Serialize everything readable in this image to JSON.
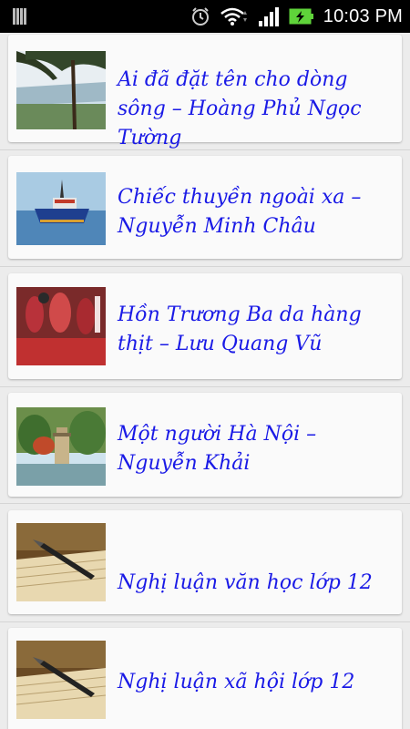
{
  "status_bar": {
    "time": "10:03 PM",
    "icons": [
      "notification-icon",
      "alarm-icon",
      "wifi-icon",
      "signal-icon",
      "battery-charging-icon"
    ]
  },
  "articles": [
    {
      "title": "Ai đã đặt tên cho dòng sông – Hoàng Phủ Ngọc Tường",
      "thumbnail": "river-landscape"
    },
    {
      "title": "Chiếc thuyền ngoài xa – Nguyễn Minh Châu",
      "thumbnail": "fishing-boat"
    },
    {
      "title": "Hồn Trương Ba da hàng thịt – Lưu Quang Vũ",
      "thumbnail": "meat-market"
    },
    {
      "title": "Một người Hà Nội – Nguyễn Khải",
      "thumbnail": "hanoi-turtle-tower"
    },
    {
      "title": "Nghị luận văn học lớp 12",
      "thumbnail": "pen-on-book"
    },
    {
      "title": "Nghị luận xã hội lớp 12",
      "thumbnail": "pen-on-book"
    }
  ],
  "colors": {
    "title_text": "#1a1ae6",
    "status_bar": "#000000",
    "battery": "#5fd33a"
  }
}
